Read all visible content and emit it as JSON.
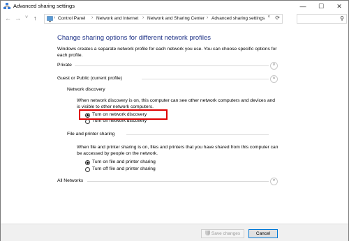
{
  "window": {
    "title": "Advanced sharing settings",
    "minimize_glyph": "—",
    "maximize_glyph": "☐",
    "close_glyph": "✕"
  },
  "address": {
    "back": "←",
    "forward": "→",
    "recent": "˅",
    "up": "↑",
    "breadcrumbs": [
      "Control Panel",
      "Network and Internet",
      "Network and Sharing Center",
      "Advanced sharing settings"
    ],
    "separator": "›",
    "dropdown": "˅",
    "refresh": "⟳"
  },
  "search": {
    "icon": "search-icon",
    "glyph": "⚲"
  },
  "page": {
    "heading": "Change sharing options for different network profiles",
    "description": "Windows creates a separate network profile for each network you use. You can choose specific options for each profile."
  },
  "profiles": {
    "private": {
      "label": "Private",
      "chevron": "˅"
    },
    "guest": {
      "label": "Guest or Public (current profile)",
      "chevron": "˄"
    },
    "all": {
      "label": "All Networks",
      "chevron": "˅"
    }
  },
  "network_discovery": {
    "title": "Network discovery",
    "text": "When network discovery is on, this computer can see other network computers and devices and is visible to other network computers.",
    "options": [
      {
        "label": "Turn on network discovery",
        "checked": true
      },
      {
        "label": "Turn off network discovery",
        "checked": false
      }
    ]
  },
  "file_sharing": {
    "title": "File and printer sharing",
    "text": "When file and printer sharing is on, files and printers that you have shared from this computer can be accessed by people on the network.",
    "options": [
      {
        "label": "Turn on file and printer sharing",
        "checked": true
      },
      {
        "label": "Turn off file and printer sharing",
        "checked": false
      }
    ]
  },
  "footer": {
    "save_label": "Save changes",
    "cancel_label": "Cancel"
  },
  "colors": {
    "heading": "#1e3287",
    "highlight": "#e00000",
    "focus": "#0078d7"
  }
}
